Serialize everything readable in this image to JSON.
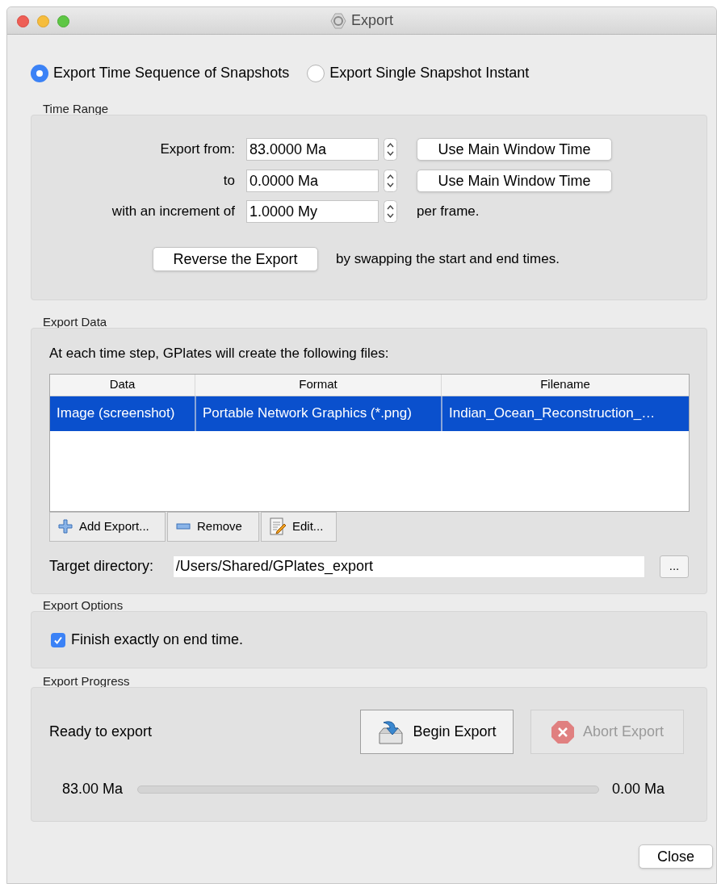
{
  "window": {
    "title": "Export"
  },
  "mode_options": [
    {
      "label": "Export Time Sequence of Snapshots",
      "selected": true
    },
    {
      "label": "Export Single Snapshot Instant",
      "selected": false
    }
  ],
  "time_range": {
    "title": "Time Range",
    "rows": [
      {
        "label": "Export from:",
        "value": "83.0000 Ma",
        "action": "Use Main Window Time"
      },
      {
        "label": "to",
        "value": "0.0000 Ma",
        "action": "Use Main Window Time"
      },
      {
        "label": "with an increment of",
        "value": "1.0000 My",
        "suffix": "per frame."
      }
    ],
    "reverse_button": "Reverse the Export",
    "reverse_note": "by swapping the start and end times."
  },
  "export_data": {
    "title": "Export Data",
    "intro": "At each time step, GPlates will create the following files:",
    "table": {
      "columns": [
        "Data",
        "Format",
        "Filename"
      ],
      "rows": [
        {
          "cells": [
            "Image (screenshot)",
            "Portable Network Graphics (*.png)",
            "Indian_Ocean_Reconstruction_…"
          ],
          "selected": true
        }
      ]
    },
    "buttons": [
      {
        "label": "Add Export...",
        "kind": "add"
      },
      {
        "label": "Remove",
        "kind": "remove"
      },
      {
        "label": "Edit...",
        "kind": "edit"
      }
    ],
    "target_label": "Target directory:",
    "target_value": "/Users/Shared/GPlates_export",
    "browse_button": "..."
  },
  "export_options": {
    "title": "Export Options",
    "checkboxes": [
      {
        "label": "Finish exactly on end time.",
        "checked": true
      }
    ]
  },
  "export_progress": {
    "title": "Export Progress",
    "status": "Ready to export",
    "buttons": [
      {
        "label": "Begin Export",
        "kind": "begin",
        "disabled": false
      },
      {
        "label": "Abort Export",
        "kind": "abort",
        "disabled": true
      }
    ],
    "start": "83.00 Ma",
    "end": "0.00 Ma",
    "level": 0
  },
  "close_button": "Close"
}
